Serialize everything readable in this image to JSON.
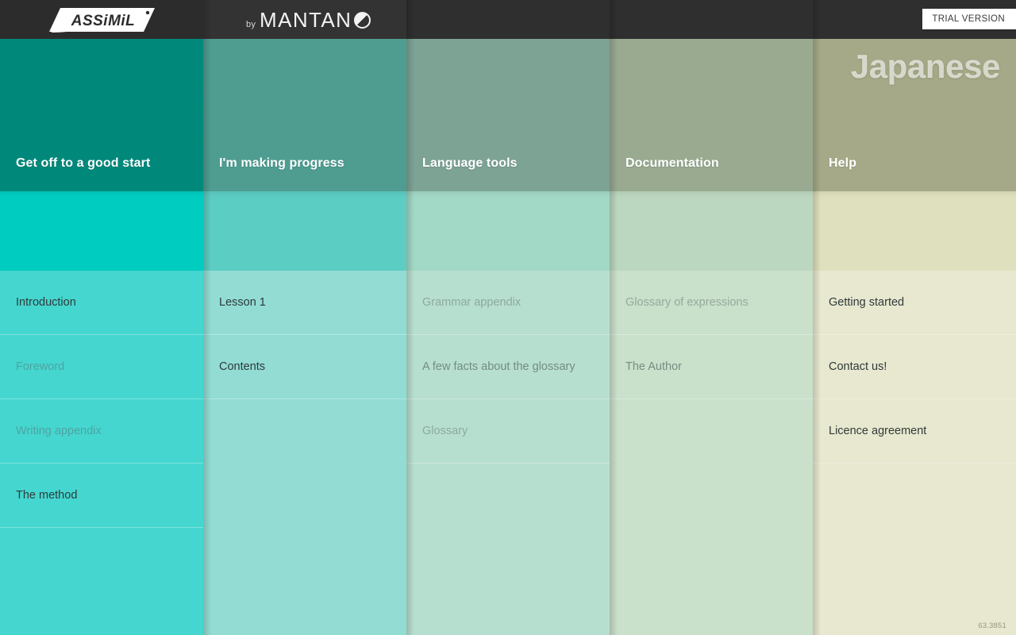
{
  "window": {
    "title": "Assimil by Mantano — Japanese",
    "version_label": "63.3851"
  },
  "branding": {
    "assimil_logo": "ASSiMiL",
    "mantano_by": "by",
    "mantano_word": "MANTAN",
    "mantano_icon": "mantano-o-icon"
  },
  "header": {
    "trial_badge": "TRIAL VERSION",
    "language_title": "Japanese"
  },
  "columns": [
    {
      "key": "get-off-to-a-good-start",
      "title": "Get off to a good start",
      "head_color": "#00897b",
      "mid_color": "#00cdc0",
      "body_color": "#45d6d0",
      "items": [
        {
          "label": "Introduction",
          "state": "enabled"
        },
        {
          "label": "Foreword",
          "state": "disabled"
        },
        {
          "label": "Writing appendix",
          "state": "disabled"
        },
        {
          "label": "The method",
          "state": "enabled"
        }
      ]
    },
    {
      "key": "im-making-progress",
      "title": "I'm making progress",
      "head_color": "#4f9d91",
      "mid_color": "#5ccdc3",
      "body_color": "#92dcd4",
      "items": [
        {
          "label": "Lesson 1",
          "state": "enabled"
        },
        {
          "label": "Contents",
          "state": "enabled"
        }
      ]
    },
    {
      "key": "language-tools",
      "title": "Language tools",
      "head_color": "#7da395",
      "mid_color": "#a2d8c6",
      "body_color": "#b7dfcf",
      "items": [
        {
          "label": "Grammar appendix",
          "state": "disabled"
        },
        {
          "label": "A few facts about the glossary",
          "state": "dim"
        },
        {
          "label": "Glossary",
          "state": "disabled"
        }
      ]
    },
    {
      "key": "documentation",
      "title": "Documentation",
      "head_color": "#99aa91",
      "mid_color": "#bcd7bf",
      "body_color": "#c9e0cb",
      "items": [
        {
          "label": "Glossary of expressions",
          "state": "disabled"
        },
        {
          "label": "The Author",
          "state": "dim"
        }
      ]
    },
    {
      "key": "help",
      "title": "Help",
      "head_color": "#a5a987",
      "mid_color": "#dfe0bd",
      "body_color": "#e7e8cf",
      "items": [
        {
          "label": "Getting started",
          "state": "enabled"
        },
        {
          "label": "Contact us!",
          "state": "enabled"
        },
        {
          "label": "Licence agreement",
          "state": "enabled"
        }
      ]
    }
  ]
}
